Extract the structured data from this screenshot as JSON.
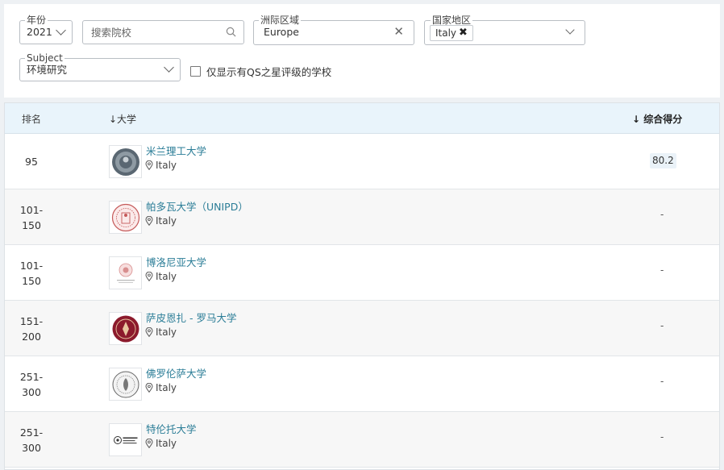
{
  "filters": {
    "year": {
      "label": "年份",
      "value": "2021"
    },
    "search": {
      "placeholder": "搜索院校"
    },
    "region": {
      "label": "洲际区域",
      "value": "Europe"
    },
    "country": {
      "label": "国家地区",
      "chip": "Italy"
    },
    "subject": {
      "label": "Subject",
      "value": "环境研究"
    },
    "qs_stars_checkbox": {
      "label": "仅显示有QS之星评级的学校",
      "checked": false
    }
  },
  "table": {
    "headers": {
      "rank": "排名",
      "university": "↓大学",
      "score": "↓ 综合得分"
    },
    "rows": [
      {
        "rank": "95",
        "name": "米兰理工大学",
        "country": "Italy",
        "score": "80.2"
      },
      {
        "rank": "101-\n150",
        "name": "帕多瓦大学（UNIPD）",
        "country": "Italy",
        "score": "-"
      },
      {
        "rank": "101-\n150",
        "name": "博洛尼亚大学",
        "country": "Italy",
        "score": "-"
      },
      {
        "rank": "151-\n200",
        "name": "萨皮恩扎 - 罗马大学",
        "country": "Italy",
        "score": "-"
      },
      {
        "rank": "251-\n300",
        "name": "佛罗伦萨大学",
        "country": "Italy",
        "score": "-"
      },
      {
        "rank": "251-\n300",
        "name": "特伦托大学",
        "country": "Italy",
        "score": "-"
      }
    ]
  },
  "icons": {
    "search": "search-icon",
    "clear": "close-icon",
    "chip_remove": "close-icon",
    "dropdown": "chevron-down-icon",
    "location": "location-pin-icon",
    "sort": "arrow-down-icon"
  },
  "colors": {
    "link": "#2b7d97",
    "header_bg": "#e9f4fb",
    "alt_row": "#f7f7f7",
    "score_badge": "#eaf2f8"
  }
}
